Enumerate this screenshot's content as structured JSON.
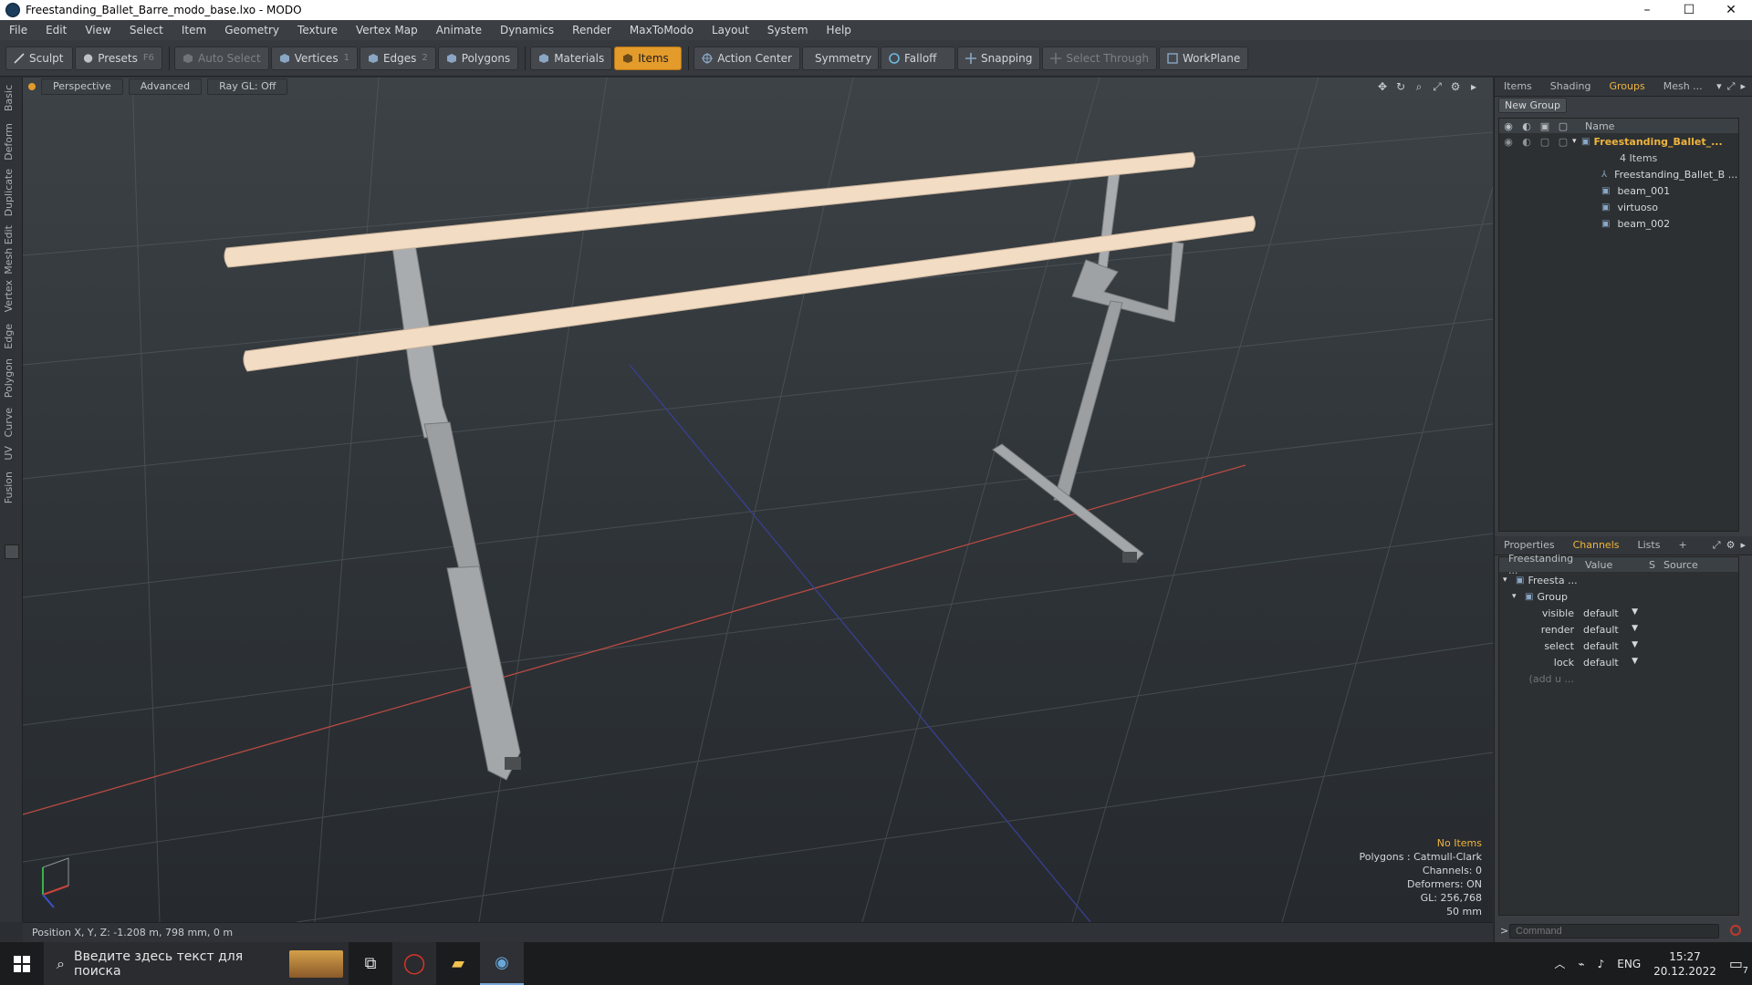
{
  "window": {
    "title": "Freestanding_Ballet_Barre_modo_base.lxo - MODO",
    "min": "–",
    "max": "☐",
    "close": "✕"
  },
  "menu": [
    "File",
    "Edit",
    "View",
    "Select",
    "Item",
    "Geometry",
    "Texture",
    "Vertex Map",
    "Animate",
    "Dynamics",
    "Render",
    "MaxToModo",
    "Layout",
    "System",
    "Help"
  ],
  "toolbar": {
    "sculpt": "Sculpt",
    "presets": "Presets",
    "presets_key": "F6",
    "auto_select": "Auto Select",
    "vertices": "Vertices",
    "vertices_key": "1",
    "edges": "Edges",
    "edges_key": "2",
    "polygons": "Polygons",
    "materials": "Materials",
    "items": "Items",
    "action_center": "Action Center",
    "symmetry": "Symmetry",
    "falloff": "Falloff",
    "snapping": "Snapping",
    "select_through": "Select Through",
    "workplane": "WorkPlane"
  },
  "left_tabs": [
    "Basic",
    "Deform",
    "Duplicate",
    "Mesh Edit",
    "Vertex",
    "Edge",
    "Polygon",
    "Curve",
    "UV",
    "Fusion"
  ],
  "viewport": {
    "tabs": [
      "Perspective",
      "Advanced",
      "Ray GL: Off"
    ],
    "info": {
      "no_items": "No Items",
      "polygons": "Polygons : Catmull-Clark",
      "channels": "Channels: 0",
      "deformers": "Deformers: ON",
      "gl": "GL: 256,768",
      "grid": "50 mm"
    },
    "status": "Position X, Y, Z:  -1.208 m, 798 mm, 0 m"
  },
  "panel_top": {
    "tabs": [
      "Items",
      "Shading",
      "Groups",
      "Mesh ..."
    ],
    "active": "Groups",
    "new_group": "New Group",
    "header_name": "Name",
    "rows": [
      {
        "name": "Freestanding_Ballet_...",
        "sub": "4 Items"
      },
      {
        "name": "Freestanding_Ballet_B ..."
      },
      {
        "name": "beam_001"
      },
      {
        "name": "virtuoso"
      },
      {
        "name": "beam_002"
      }
    ]
  },
  "panel_bottom": {
    "tabs": [
      "Properties",
      "Channels",
      "Lists",
      "+"
    ],
    "active": "Channels",
    "headers": [
      "Freestanding ...",
      "Value",
      "S",
      "Source"
    ],
    "tree": [
      "Freesta ...",
      "Group"
    ],
    "channels": [
      {
        "label": "visible",
        "value": "default"
      },
      {
        "label": "render",
        "value": "default"
      },
      {
        "label": "select",
        "value": "default"
      },
      {
        "label": "lock",
        "value": "default"
      }
    ],
    "add": "(add u ...",
    "command_placeholder": "Command"
  },
  "taskbar": {
    "search_placeholder": "Введите здесь текст для поиска",
    "lang": "ENG",
    "time": "15:27",
    "date": "20.12.2022",
    "notif_count": "7"
  },
  "colors": {
    "accent": "#e39b2b",
    "wood": "#f2dcc4",
    "metal": "#9a9d9f"
  }
}
